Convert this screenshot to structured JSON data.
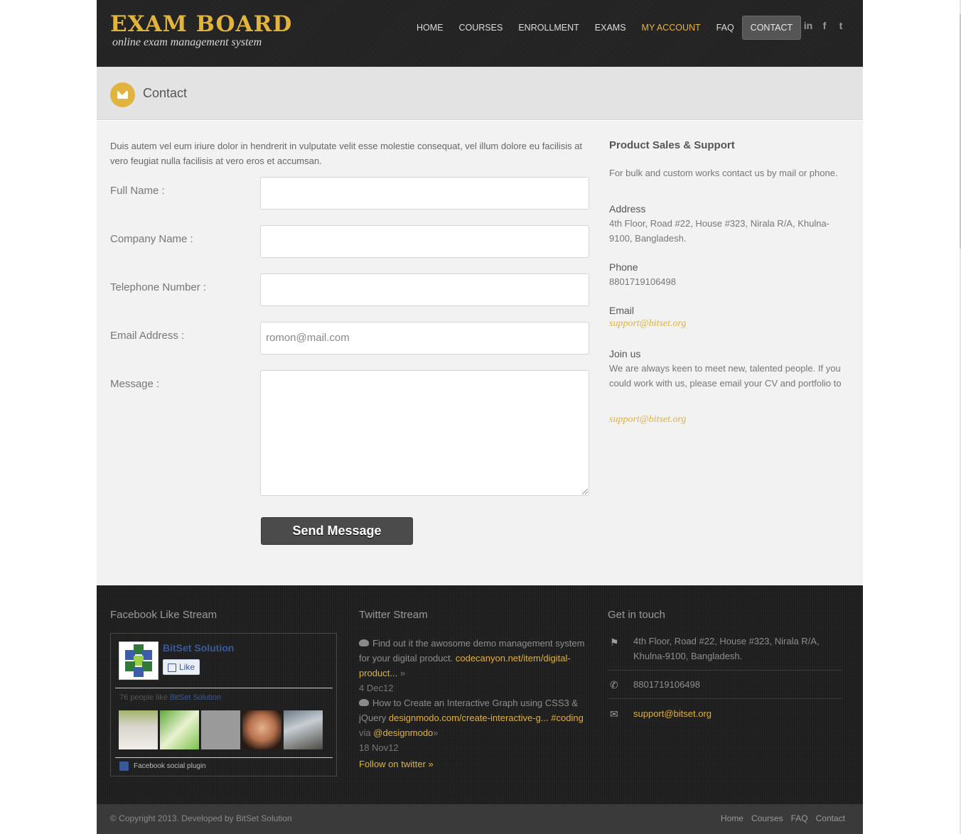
{
  "header": {
    "logo_title": "EXAM BOARD",
    "logo_subtitle": "online exam management system",
    "nav": [
      {
        "label": "HOME"
      },
      {
        "label": "COURSES"
      },
      {
        "label": "ENROLLMENT"
      },
      {
        "label": "EXAMS"
      },
      {
        "label": "MY ACCOUNT"
      },
      {
        "label": "FAQ"
      },
      {
        "label": "CONTACT"
      }
    ],
    "social_icons": [
      "linkedin-icon",
      "facebook-icon",
      "twitter-icon"
    ],
    "social_glyphs": [
      "in",
      "f",
      "t"
    ],
    "accent_color": "#e1b13e"
  },
  "title_bar": {
    "title": "Contact",
    "icon": "envelope-icon"
  },
  "contact_form": {
    "intro": "Duis autem vel eum iriure dolor in hendrerit in vulputate velit esse molestie consequat, vel illum dolore eu facilisis at vero feugiat nulla facilisis at vero eros et accumsan.",
    "fields": [
      {
        "label": "Full Name :",
        "value": ""
      },
      {
        "label": "Company Name :",
        "value": ""
      },
      {
        "label": "Telephone Number :",
        "value": ""
      },
      {
        "label": "Email Address :",
        "value": "romon@mail.com"
      }
    ],
    "message_label": "Message :",
    "message_value": "",
    "submit_label": "Send Message"
  },
  "sidebar": {
    "heading": "Product Sales & Support",
    "text": "For bulk and custom works contact us by mail or phone.",
    "address_label": "Address",
    "address": "4th Floor, Road #22, House #323, Nirala R/A, Khulna-9100, Bangladesh.",
    "phone_label": "Phone",
    "phone": "8801719106498",
    "email_label": "Email",
    "email": "support@bitset.org",
    "join_label": "Join us",
    "join_text": "We are always keen to meet new, talented people. If you could work with us, please email your CV and portfolio to",
    "join_email": "support@bitset.org"
  },
  "footer": {
    "facebook": {
      "heading": "Facebook Like Stream",
      "page_name": "BitSet Solution",
      "like_label": "Like",
      "count_text": "76 people like",
      "count_name": "BitSet Solution",
      "plugin_label": "Facebook social plugin"
    },
    "twitter": {
      "heading": "Twitter Stream",
      "tweets": [
        {
          "text": "Find out it the awosome demo management system for your digital product.",
          "link": "codecanyon.net/item/digital-product...",
          "arrow": "»",
          "date": "4 Dec12"
        },
        {
          "text": "How to Create an Interactive Graph using CSS3 & jQuery",
          "link": "designmodo.com/create-interactive-g...",
          "hashtag": "#coding",
          "via": "via",
          "handle": "@designmodo",
          "arrow": "»",
          "date": "18 Nov12"
        }
      ],
      "follow_label": "Follow on twitter »"
    },
    "get_in_touch": {
      "heading": "Get in touch",
      "address": "4th Floor, Road #22, House #323, Nirala R/A, Khulna-9100, Bangladesh.",
      "phone": "8801719106498",
      "email": "support@bitset.org"
    }
  },
  "bottom_bar": {
    "copyright": "© Copyright 2013. Developed by BitSet Solution",
    "links": [
      {
        "label": "Home"
      },
      {
        "label": "Courses"
      },
      {
        "label": "FAQ"
      },
      {
        "label": "Contact"
      }
    ]
  }
}
